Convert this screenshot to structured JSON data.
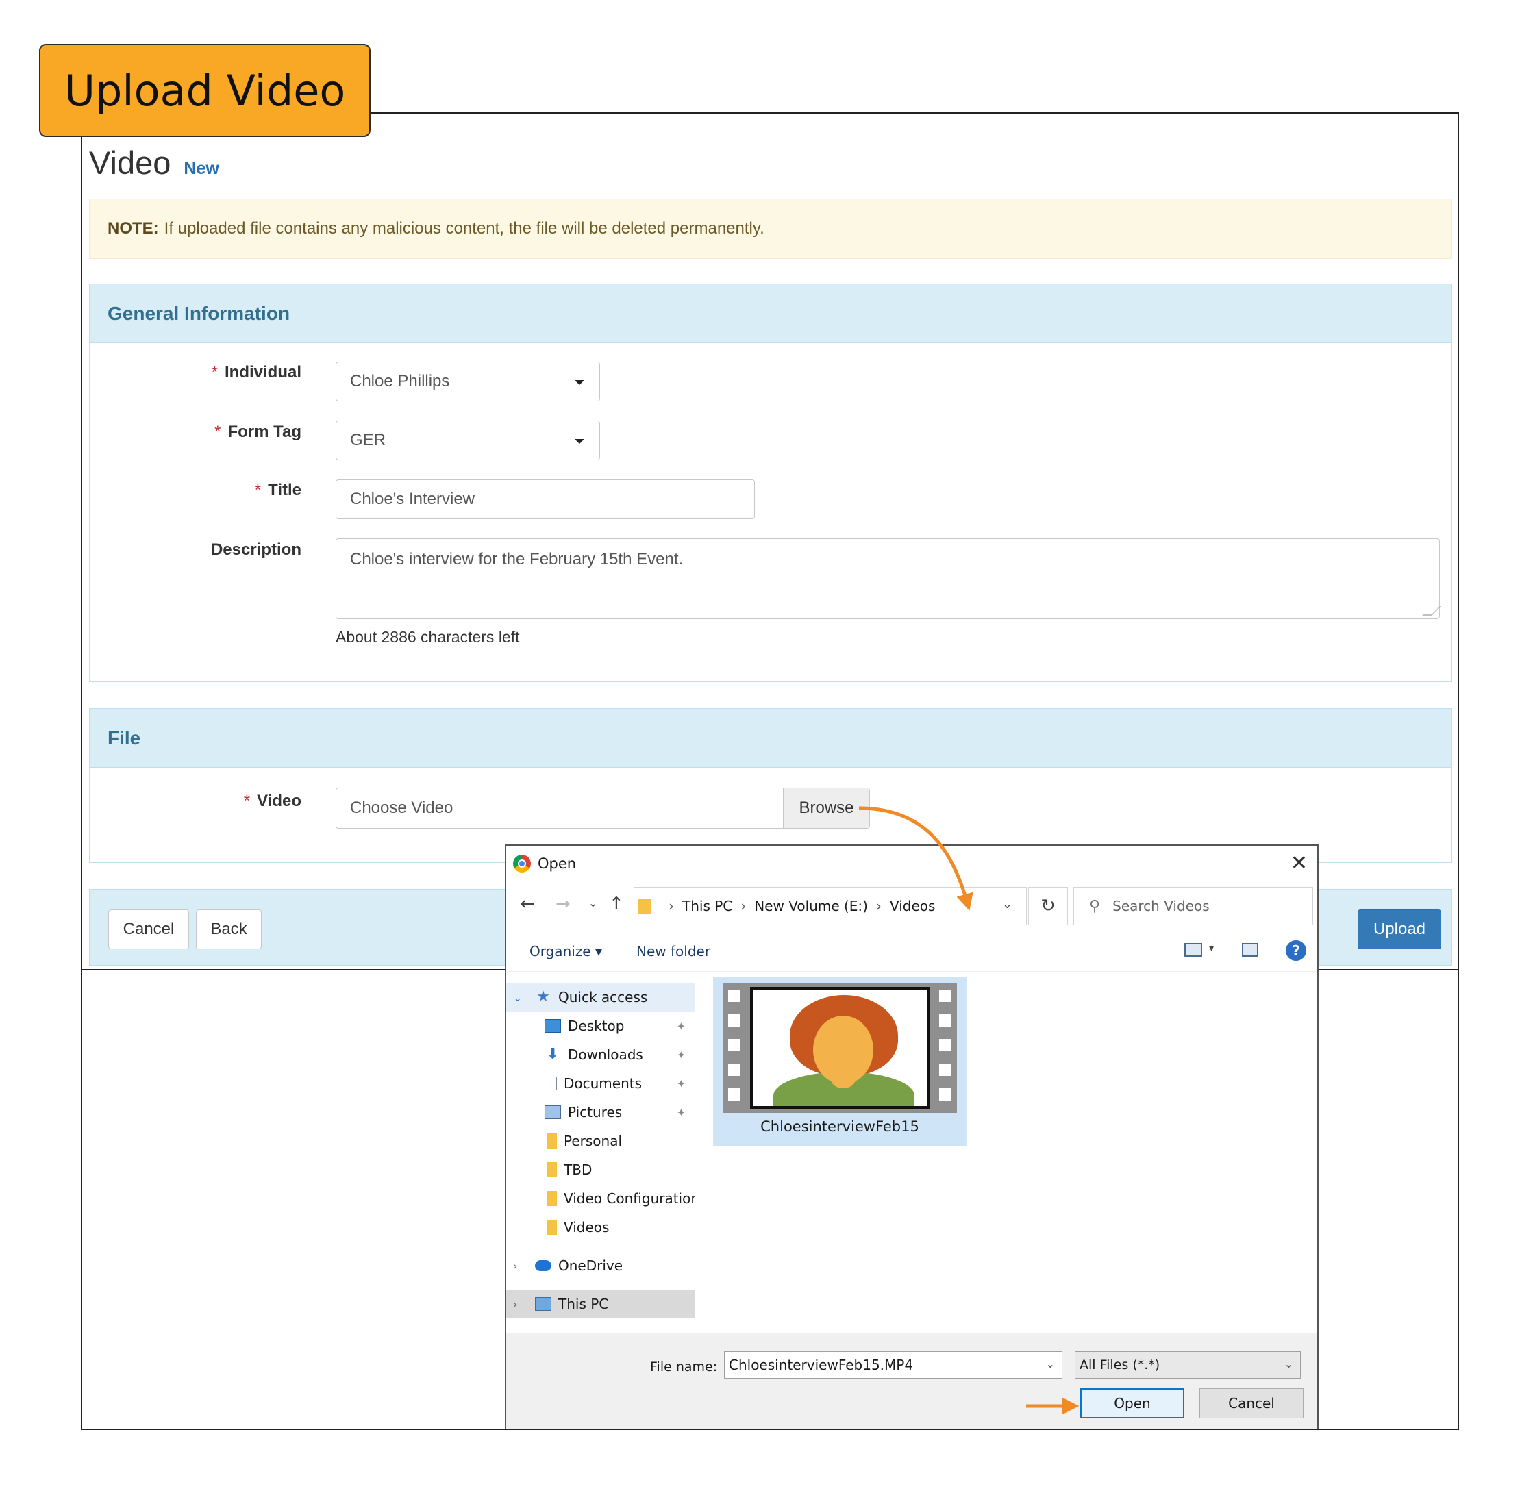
{
  "callout": {
    "label": "Upload Video"
  },
  "page": {
    "title": "Video",
    "badge": "New",
    "note_label": "NOTE:",
    "note_text": "If uploaded file contains any malicious content, the file will be deleted permanently."
  },
  "general": {
    "heading": "General Information",
    "individual": {
      "label": "Individual",
      "value": "Chloe Phillips"
    },
    "form_tag": {
      "label": "Form Tag",
      "value": "GER"
    },
    "title": {
      "label": "Title",
      "value": "Chloe's Interview"
    },
    "description": {
      "label": "Description",
      "value": "Chloe's interview for the February 15th Event."
    },
    "chars_left": "About 2886 characters left",
    "required_mark": "*"
  },
  "file": {
    "heading": "File",
    "video_label": "Video",
    "placeholder": "Choose Video",
    "browse": "Browse"
  },
  "footer": {
    "cancel": "Cancel",
    "back": "Back",
    "upload": "Upload"
  },
  "dialog": {
    "title": "Open",
    "close": "✕",
    "breadcrumb": [
      "This PC",
      "New Volume (E:)",
      "Videos"
    ],
    "search_placeholder": "Search Videos",
    "organize": "Organize ▾",
    "new_folder": "New folder",
    "help": "?",
    "sidebar": [
      {
        "label": "Quick access",
        "icon": "star-icon"
      },
      {
        "label": "Desktop",
        "icon": "desktop-icon"
      },
      {
        "label": "Downloads",
        "icon": "download-icon"
      },
      {
        "label": "Documents",
        "icon": "documents-icon"
      },
      {
        "label": "Pictures",
        "icon": "pictures-icon"
      },
      {
        "label": "Personal",
        "icon": "folder-icon"
      },
      {
        "label": "TBD",
        "icon": "folder-icon"
      },
      {
        "label": "Video Configuratior",
        "icon": "folder-icon"
      },
      {
        "label": "Videos",
        "icon": "folder-icon"
      },
      {
        "label": "OneDrive",
        "icon": "cloud-icon"
      },
      {
        "label": "This PC",
        "icon": "computer-icon"
      }
    ],
    "file_item": "ChloesinterviewFeb15",
    "file_name_label": "File name:",
    "file_name_value": "ChloesinterviewFeb15.MP4",
    "file_type": "All Files (*.*)",
    "open": "Open",
    "cancel": "Cancel"
  },
  "colors": {
    "callout": "#F9A825",
    "arrow": "#F08A24",
    "primary": "#337ab7",
    "panel_head": "#d9edf7"
  }
}
